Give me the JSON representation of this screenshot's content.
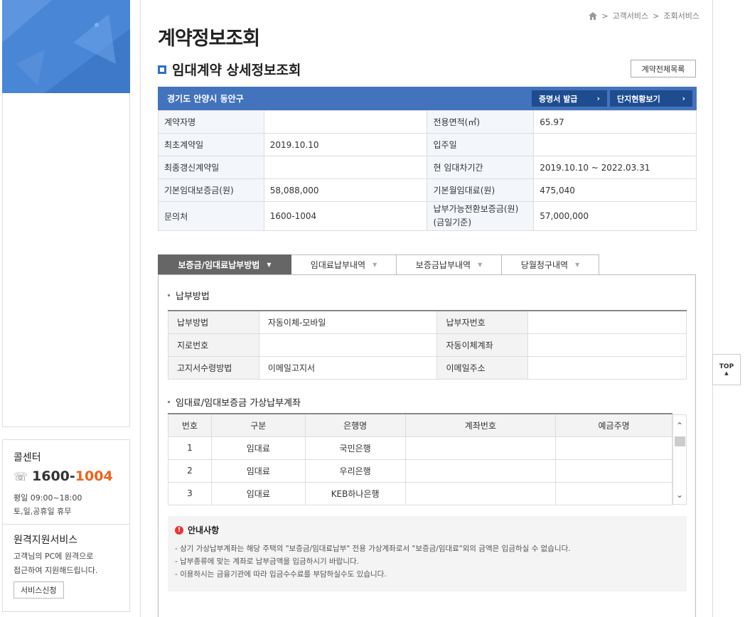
{
  "breadcrumb": {
    "items": [
      "고객서비스",
      "조회서비스"
    ]
  },
  "page_title": "계약정보조회",
  "section_title": "임대계약 상세정보조회",
  "list_button": "계약전체목록",
  "info_header": {
    "address": "경기도 안양시 동안구",
    "certificate_button": "증명서 발급",
    "complex_button": "단지현황보기"
  },
  "info_table": {
    "rows": [
      {
        "l1": "계약자명",
        "v1": "",
        "l2": "전용면적(㎡)",
        "v2": "65.97"
      },
      {
        "l1": "최초계약일",
        "v1": "2019.10.10",
        "l2": "입주일",
        "v2": ""
      },
      {
        "l1": "최종갱신계약일",
        "v1": "",
        "l2": "현 임대차기간",
        "v2": "2019.10.10 ~ 2022.03.31"
      },
      {
        "l1": "기본임대보증금(원)",
        "v1": "58,088,000",
        "l2": "기본월임대료(원)",
        "v2": "475,040"
      },
      {
        "l1": "문의처",
        "v1": "1600-1004",
        "l2": "납부가능전환보증금(원)",
        "l2b": "(금일기준)",
        "v2": "57,000,000"
      }
    ]
  },
  "tabs": [
    "보증금/임대료납부방법",
    "임대료납부내역",
    "보증금납부내역",
    "당월청구내역"
  ],
  "payment": {
    "title": "납부방법",
    "rows": [
      {
        "l1": "납부방법",
        "v1": "자동이체-모바일",
        "l2": "납부자번호",
        "v2": ""
      },
      {
        "l1": "지로번호",
        "v1": "",
        "l2": "자동이체계좌",
        "v2": ""
      },
      {
        "l1": "고지서수령방법",
        "v1": "이메일고지서",
        "l2": "이메일주소",
        "v2": ""
      }
    ]
  },
  "accounts": {
    "title": "임대료/임대보증금 가상납부계좌",
    "headers": [
      "번호",
      "구분",
      "은행명",
      "계좌번호",
      "예금주명"
    ],
    "rows": [
      [
        "1",
        "임대료",
        "국민은행",
        "",
        ""
      ],
      [
        "2",
        "임대료",
        "우리은행",
        "",
        ""
      ],
      [
        "3",
        "임대료",
        "KEB하나은행",
        "",
        ""
      ]
    ]
  },
  "notice": {
    "title": "안내사항",
    "lines": [
      "- 상기 가상납부계좌는 해당 주택의 \"보증금/임대료납부\" 전용 가상계좌로서 \"보증금/임대료\"외의 금액은 입금하실 수 없습니다.",
      "- 납부종류에 맞는 계좌로 납부금액을 입금하시기 바랍니다.",
      "- 이용하시는 금융기관에 따라 입금수수료를 부담하실수도 있습니다."
    ]
  },
  "sidebar": {
    "callcenter_title": "콜센터",
    "phone_a": "1600-",
    "phone_b": "1004",
    "hours1": "평일 09:00~18:00",
    "hours2": "토,일,공휴일 휴무",
    "remote_title": "원격지원서비스",
    "remote_desc1": "고객님의 PC에 원격으로",
    "remote_desc2": "접근하여 지원해드립니다.",
    "remote_button": "서비스신청"
  },
  "top_button": "TOP",
  "colors": {
    "accent": "#4373bd",
    "dark_button": "#1e4c8f",
    "orange": "#f0621a"
  }
}
